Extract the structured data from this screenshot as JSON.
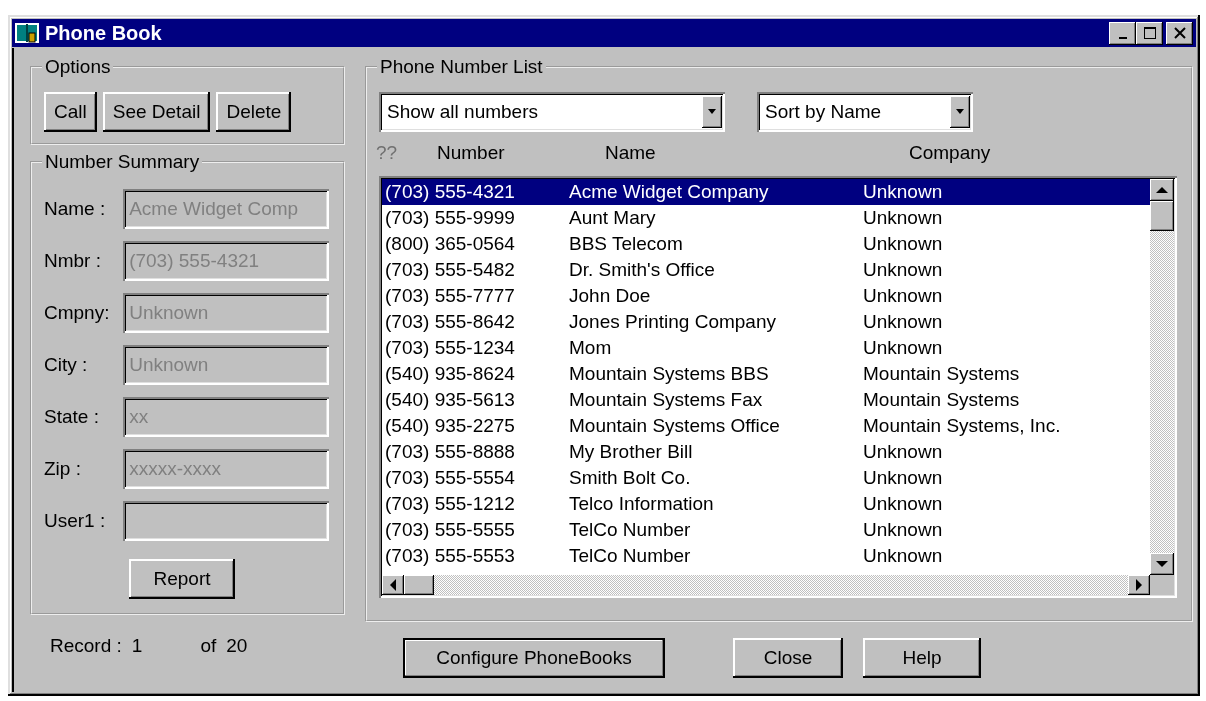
{
  "window": {
    "title": "Phone Book"
  },
  "options": {
    "title": "Options",
    "buttons": [
      "Call",
      "See Detail",
      "Delete"
    ]
  },
  "summary": {
    "title": "Number Summary",
    "fields": [
      {
        "label": "Name :",
        "value": "Acme Widget Comp",
        "disabled": true
      },
      {
        "label": "Nmbr :",
        "value": "(703) 555-4321",
        "disabled": true
      },
      {
        "label": "Cmpny:",
        "value": "Unknown",
        "disabled": true
      },
      {
        "label": "City :",
        "value": "Unknown",
        "disabled": true
      },
      {
        "label": "State :",
        "value": "xx",
        "disabled": true
      },
      {
        "label": "Zip :",
        "value": "xxxxx-xxxx",
        "disabled": true
      },
      {
        "label": "User1 :",
        "disabled": true
      }
    ],
    "report_button": "Report"
  },
  "record": {
    "label": "Record :",
    "current": "1",
    "of_label": "of",
    "total": "20"
  },
  "phone_list": {
    "title": "Phone Number List",
    "filter": "Show all numbers",
    "sort": "Sort by Name",
    "columns": [
      {
        "label": "??",
        "disabled": true
      },
      {
        "label": "Number",
        "disabled": false
      },
      {
        "label": "Name",
        "disabled": false
      },
      {
        "label": "Company",
        "disabled": false
      }
    ],
    "rows": [
      {
        "number": "(703) 555-4321",
        "name": "Acme Widget Company",
        "company": "Unknown",
        "selected": true
      },
      {
        "number": "(703) 555-9999",
        "name": "Aunt Mary",
        "company": "Unknown",
        "selected": false
      },
      {
        "number": "(800) 365-0564",
        "name": "BBS Telecom",
        "company": "Unknown",
        "selected": false
      },
      {
        "number": "(703) 555-5482",
        "name": "Dr. Smith's Office",
        "company": "Unknown",
        "selected": false
      },
      {
        "number": "(703) 555-7777",
        "name": "John Doe",
        "company": "Unknown",
        "selected": false
      },
      {
        "number": "(703) 555-8642",
        "name": "Jones Printing Company",
        "company": "Unknown",
        "selected": false
      },
      {
        "number": "(703) 555-1234",
        "name": "Mom",
        "company": "Unknown",
        "selected": false
      },
      {
        "number": "(540) 935-8624",
        "name": "Mountain Systems BBS",
        "company": "Mountain Systems",
        "selected": false
      },
      {
        "number": "(540) 935-5613",
        "name": "Mountain Systems Fax",
        "company": "Mountain Systems",
        "selected": false
      },
      {
        "number": "(540) 935-2275",
        "name": "Mountain Systems Office",
        "company": "Mountain Systems, Inc.",
        "selected": false
      },
      {
        "number": "(703) 555-8888",
        "name": "My Brother Bill",
        "company": "Unknown",
        "selected": false
      },
      {
        "number": "(703) 555-5554",
        "name": "Smith Bolt Co.",
        "company": "Unknown",
        "selected": false
      },
      {
        "number": "(703) 555-1212",
        "name": "Telco Information",
        "company": "Unknown",
        "selected": false
      },
      {
        "number": "(703) 555-5555",
        "name": "TelCo Number",
        "company": "Unknown",
        "selected": false
      },
      {
        "number": "(703) 555-5553",
        "name": "TelCo Number",
        "company": "Unknown",
        "selected": false
      }
    ]
  },
  "buttons": [
    "Configure PhoneBooks",
    "Close",
    "Help"
  ]
}
